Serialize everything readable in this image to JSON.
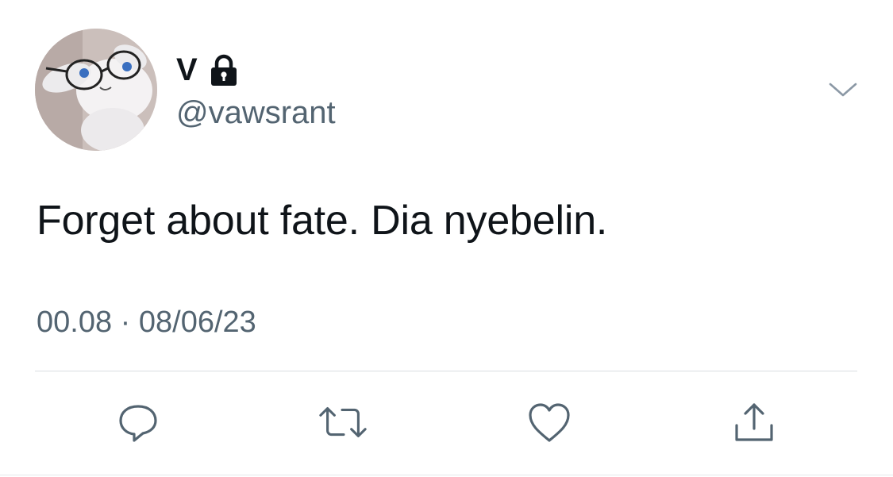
{
  "author": {
    "display_name": "V",
    "handle": "@vawsrant",
    "protected": true
  },
  "icons": {
    "avatar": "avatar-image",
    "lock": "lock-icon",
    "more": "chevron-down-icon",
    "reply": "reply-icon",
    "retweet": "retweet-icon",
    "like": "heart-icon",
    "share": "share-icon"
  },
  "tweet": {
    "text": "Forget about fate. Dia nyebelin.",
    "time": "00.08",
    "separator": "·",
    "date": "08/06/23"
  },
  "colors": {
    "text_primary": "#0f1419",
    "text_secondary": "#536471",
    "divider": "#d9dde1"
  }
}
